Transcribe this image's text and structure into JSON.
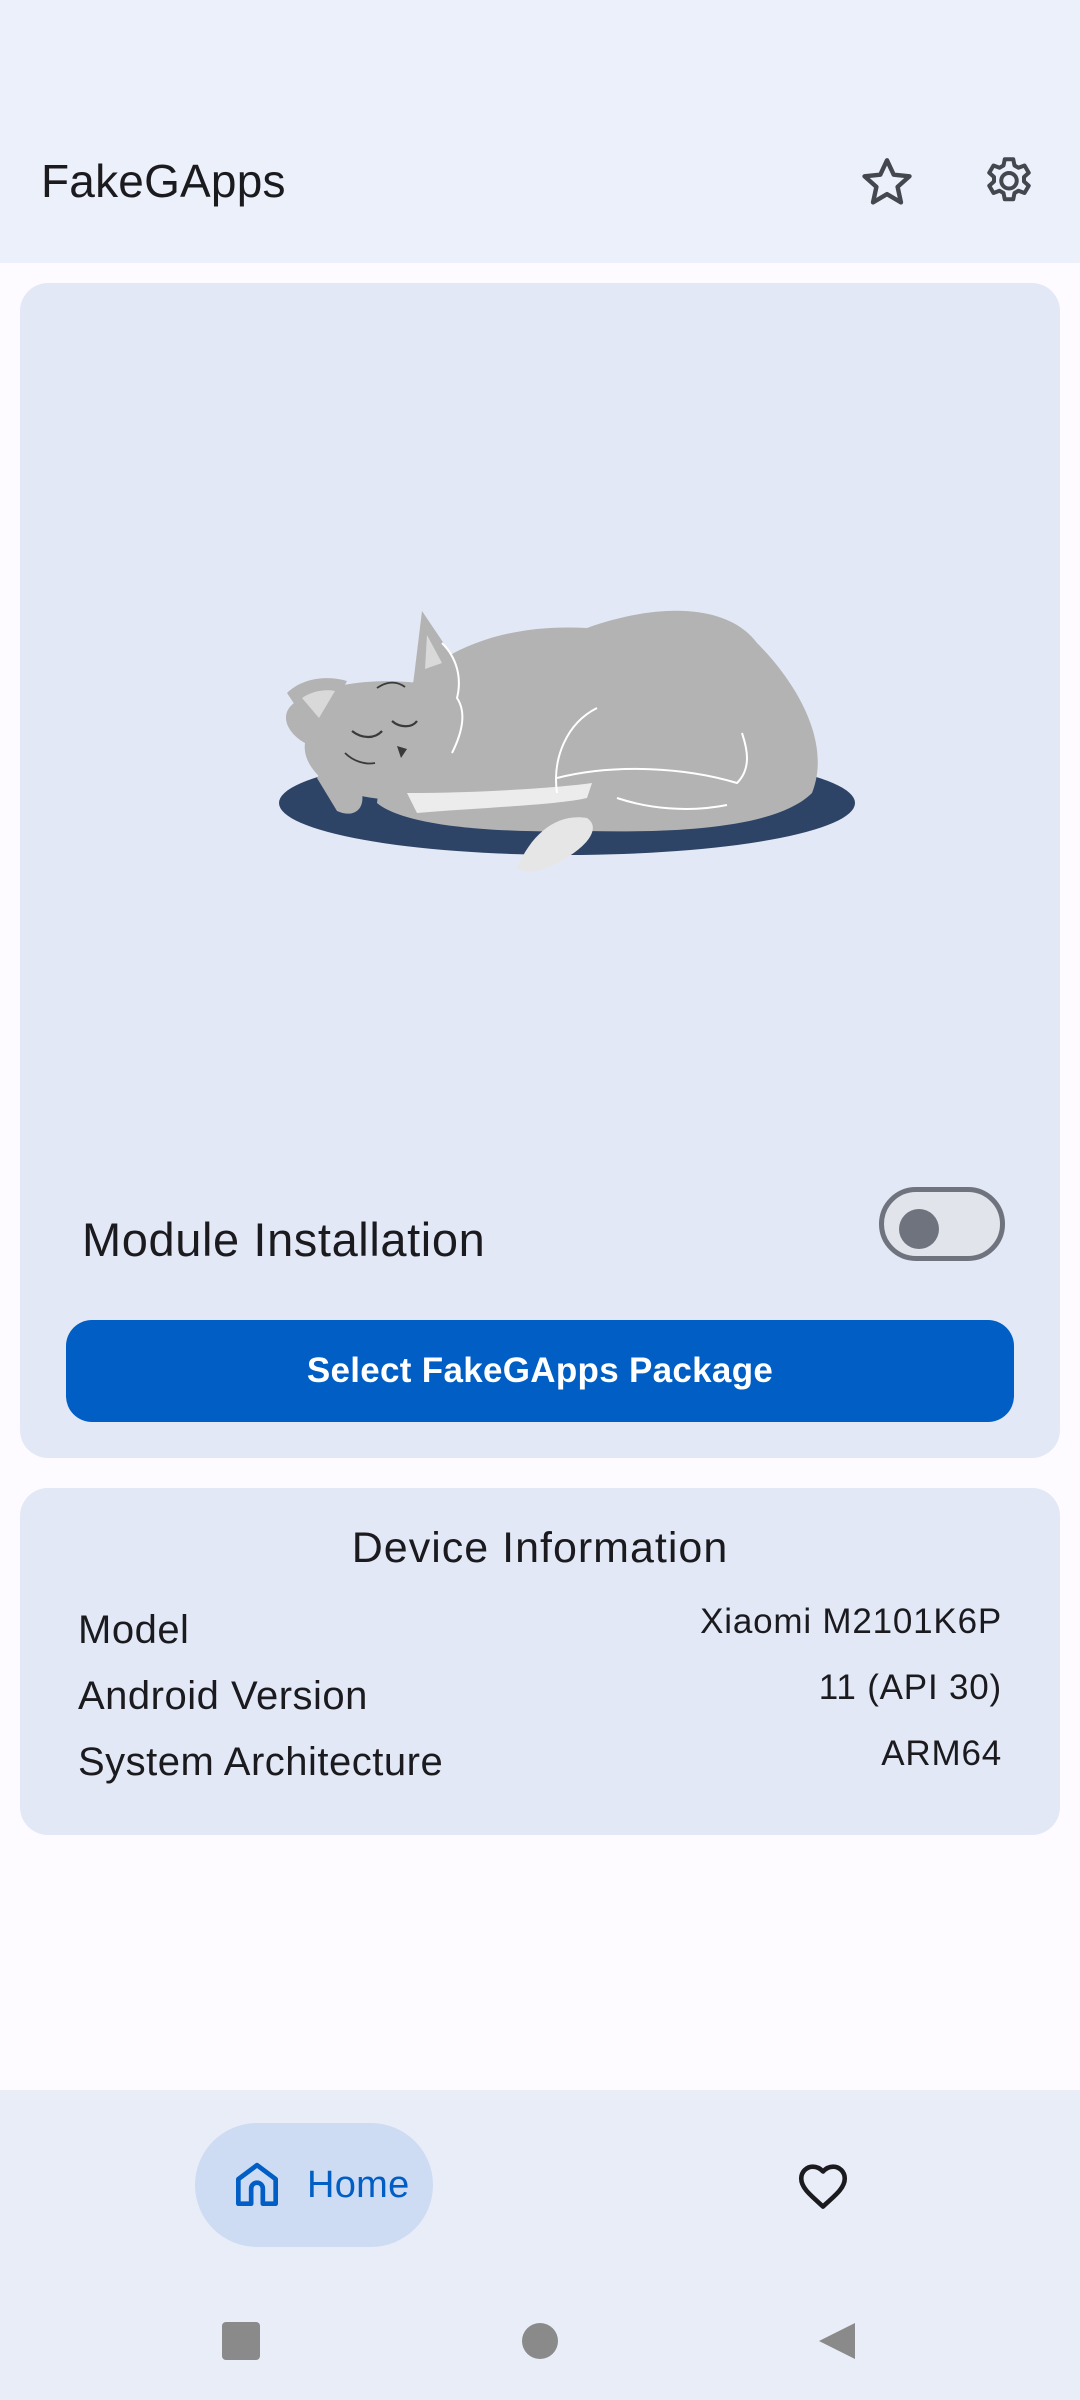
{
  "app": {
    "title": "FakeGApps"
  },
  "top_bar": {
    "actions": [
      {
        "icon": "star-icon"
      },
      {
        "icon": "gear-icon"
      }
    ]
  },
  "install_card": {
    "illustration": "sleeping-cat-illustration",
    "module_label": "Module Installation",
    "module_enabled": false,
    "select_button_label": "Select FakeGApps Package"
  },
  "device_info": {
    "title": "Device Information",
    "rows": [
      {
        "key": "Model",
        "value": "Xiaomi M2101K6P"
      },
      {
        "key": "Android Version",
        "value": "11 (API 30)"
      },
      {
        "key": "System Architecture",
        "value": "ARM64"
      }
    ]
  },
  "bottom_nav": {
    "items": [
      {
        "label": "Home",
        "icon": "home-icon",
        "selected": true
      },
      {
        "label": "",
        "icon": "heart-icon",
        "selected": false
      }
    ]
  },
  "system_nav": {
    "buttons": [
      "recents-icon",
      "home-circle-icon",
      "back-icon"
    ]
  },
  "colors": {
    "primary": "#005ec4",
    "surface": "#ecf0fa",
    "card": "#e2e8f6",
    "nav_selected": "#cddcf3",
    "on_surface": "#1b1b1f",
    "outline": "#6f737e",
    "cat_mat": "#2e4466",
    "cat_fur": "#b3b3b3"
  }
}
